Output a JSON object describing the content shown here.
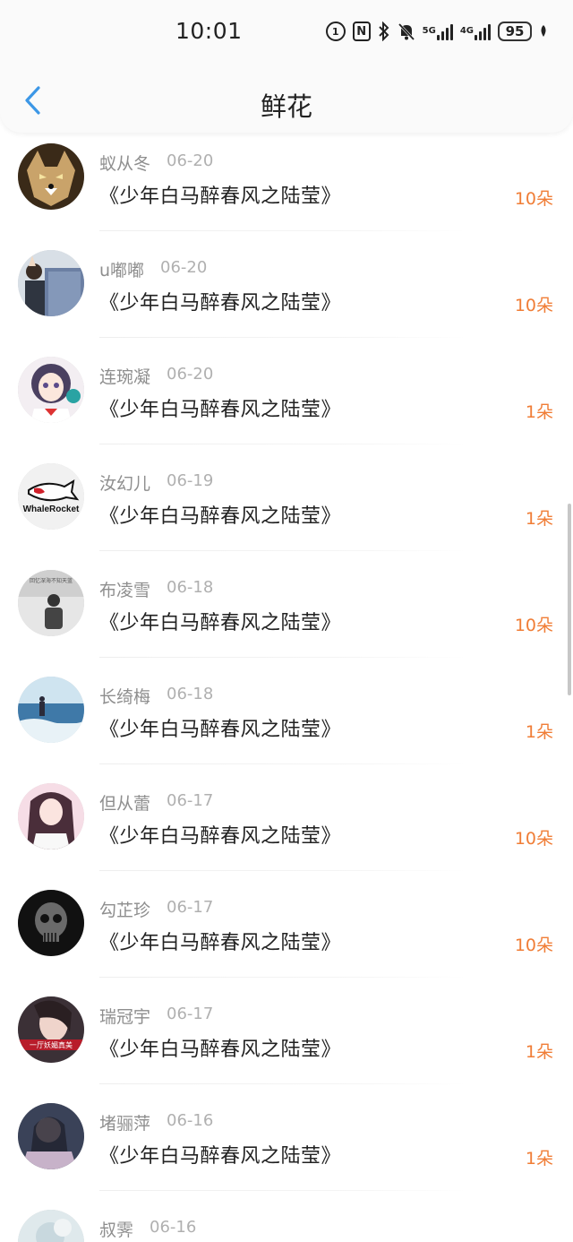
{
  "status_bar": {
    "time": "10:01",
    "icons": [
      "timer-icon",
      "nfc-icon",
      "bluetooth-icon",
      "mute-icon",
      "signal-5g-icon",
      "signal-4g-icon",
      "battery-icon",
      "leaf-icon"
    ],
    "net_5g": "5G",
    "net_4g": "4G",
    "battery": "95"
  },
  "header": {
    "back_icon": "chevron-left-icon",
    "title": "鲜花",
    "accent": "#3c97e6"
  },
  "colors": {
    "count": "#f07d36",
    "name": "#8e8e8e",
    "date": "#b0b0b0"
  },
  "items": [
    {
      "name": "蚁从冬",
      "date": "06-20",
      "title": "《少年白马醉春风之陆莹》",
      "count": "10朵",
      "avatar": "wolf"
    },
    {
      "name": "u嘟嘟",
      "date": "06-20",
      "title": "《少年白马醉春风之陆莹》",
      "count": "10朵",
      "avatar": "couple"
    },
    {
      "name": "连琬凝",
      "date": "06-20",
      "title": "《少年白马醉春风之陆莹》",
      "count": "1朵",
      "avatar": "anime-girl"
    },
    {
      "name": "汝幻儿",
      "date": "06-19",
      "title": "《少年白马醉春风之陆莹》",
      "count": "1朵",
      "avatar": "whalerocket"
    },
    {
      "name": "布凌雪",
      "date": "06-18",
      "title": "《少年白马醉春风之陆莹》",
      "count": "10朵",
      "avatar": "bw-person"
    },
    {
      "name": "长绮梅",
      "date": "06-18",
      "title": "《少年白马醉春风之陆莹》",
      "count": "1朵",
      "avatar": "sea"
    },
    {
      "name": "但从蕾",
      "date": "06-17",
      "title": "《少年白马醉春风之陆莹》",
      "count": "10朵",
      "avatar": "girl-pink"
    },
    {
      "name": "勾芷珍",
      "date": "06-17",
      "title": "《少年白马醉春风之陆莹》",
      "count": "10朵",
      "avatar": "skull"
    },
    {
      "name": "瑞冠宇",
      "date": "06-17",
      "title": "《少年白马醉春风之陆莹》",
      "count": "1朵",
      "avatar": "woman-red"
    },
    {
      "name": "堵骊萍",
      "date": "06-16",
      "title": "《少年白马醉春风之陆莹》",
      "count": "1朵",
      "avatar": "dark-girl"
    },
    {
      "name": "叔霁",
      "date": "06-16",
      "title": "",
      "count": "",
      "avatar": "light"
    }
  ],
  "avatar_badge_text": "WhaleRocket",
  "avatar_caption_text": "回忆深海不知天蓝",
  "avatar_banner_text": "一厅妖媚真美"
}
